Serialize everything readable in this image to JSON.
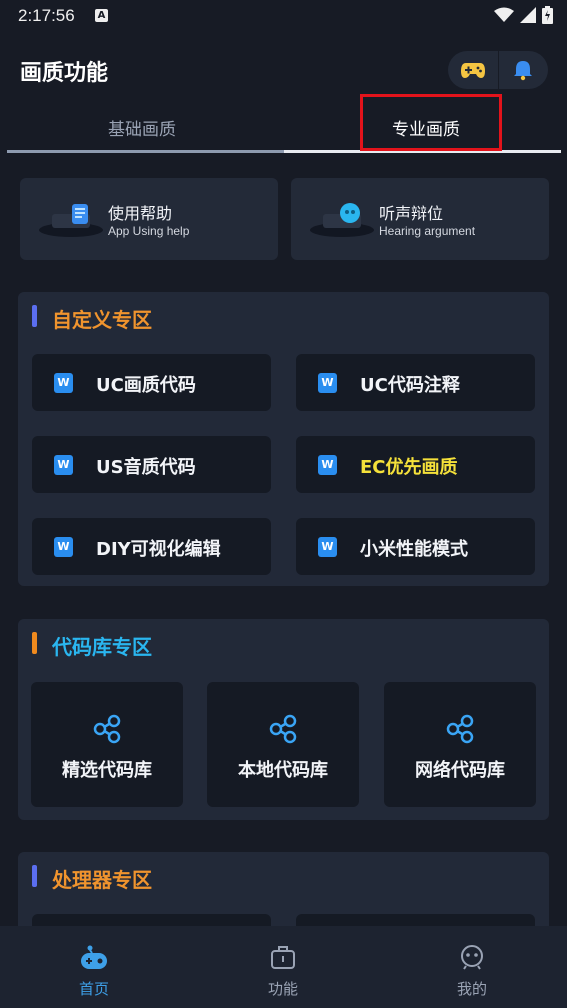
{
  "status_bar": {
    "time": "2:17:56",
    "notification_badge": "A"
  },
  "header": {
    "title": "画质功能"
  },
  "tabs": [
    {
      "label": "基础画质",
      "active": false
    },
    {
      "label": "专业画质",
      "active": true
    }
  ],
  "help_cards": [
    {
      "title": "使用帮助",
      "subtitle": "App Using help"
    },
    {
      "title": "听声辩位",
      "subtitle": "Hearing argument"
    }
  ],
  "custom_section": {
    "title": "自定义专区",
    "items": [
      {
        "label": "UC画质代码"
      },
      {
        "label": "UC代码注释"
      },
      {
        "label": "US音质代码"
      },
      {
        "label": "EC优先画质"
      },
      {
        "label": "DIY可视化编辑"
      },
      {
        "label": "小米性能模式"
      }
    ]
  },
  "library_section": {
    "title": "代码库专区",
    "items": [
      {
        "label": "精选代码库"
      },
      {
        "label": "本地代码库"
      },
      {
        "label": "网络代码库"
      }
    ]
  },
  "processor_section": {
    "title": "处理器专区"
  },
  "bottom_nav": [
    {
      "label": "首页",
      "active": true
    },
    {
      "label": "功能",
      "active": false
    },
    {
      "label": "我的",
      "active": false
    }
  ],
  "colors": {
    "background": "#171b25",
    "card": "#222938",
    "orange_title": "#f0942e",
    "blue_title": "#2ab6f0",
    "yellow_item": "#f5e13a",
    "active_nav": "#3ea0e8",
    "highlight_box": "#e3131b"
  },
  "icons": {
    "header_left": "gamepad-icon",
    "header_right": "bell-icon",
    "items": "word-doc-icon",
    "library": "share-icon"
  }
}
